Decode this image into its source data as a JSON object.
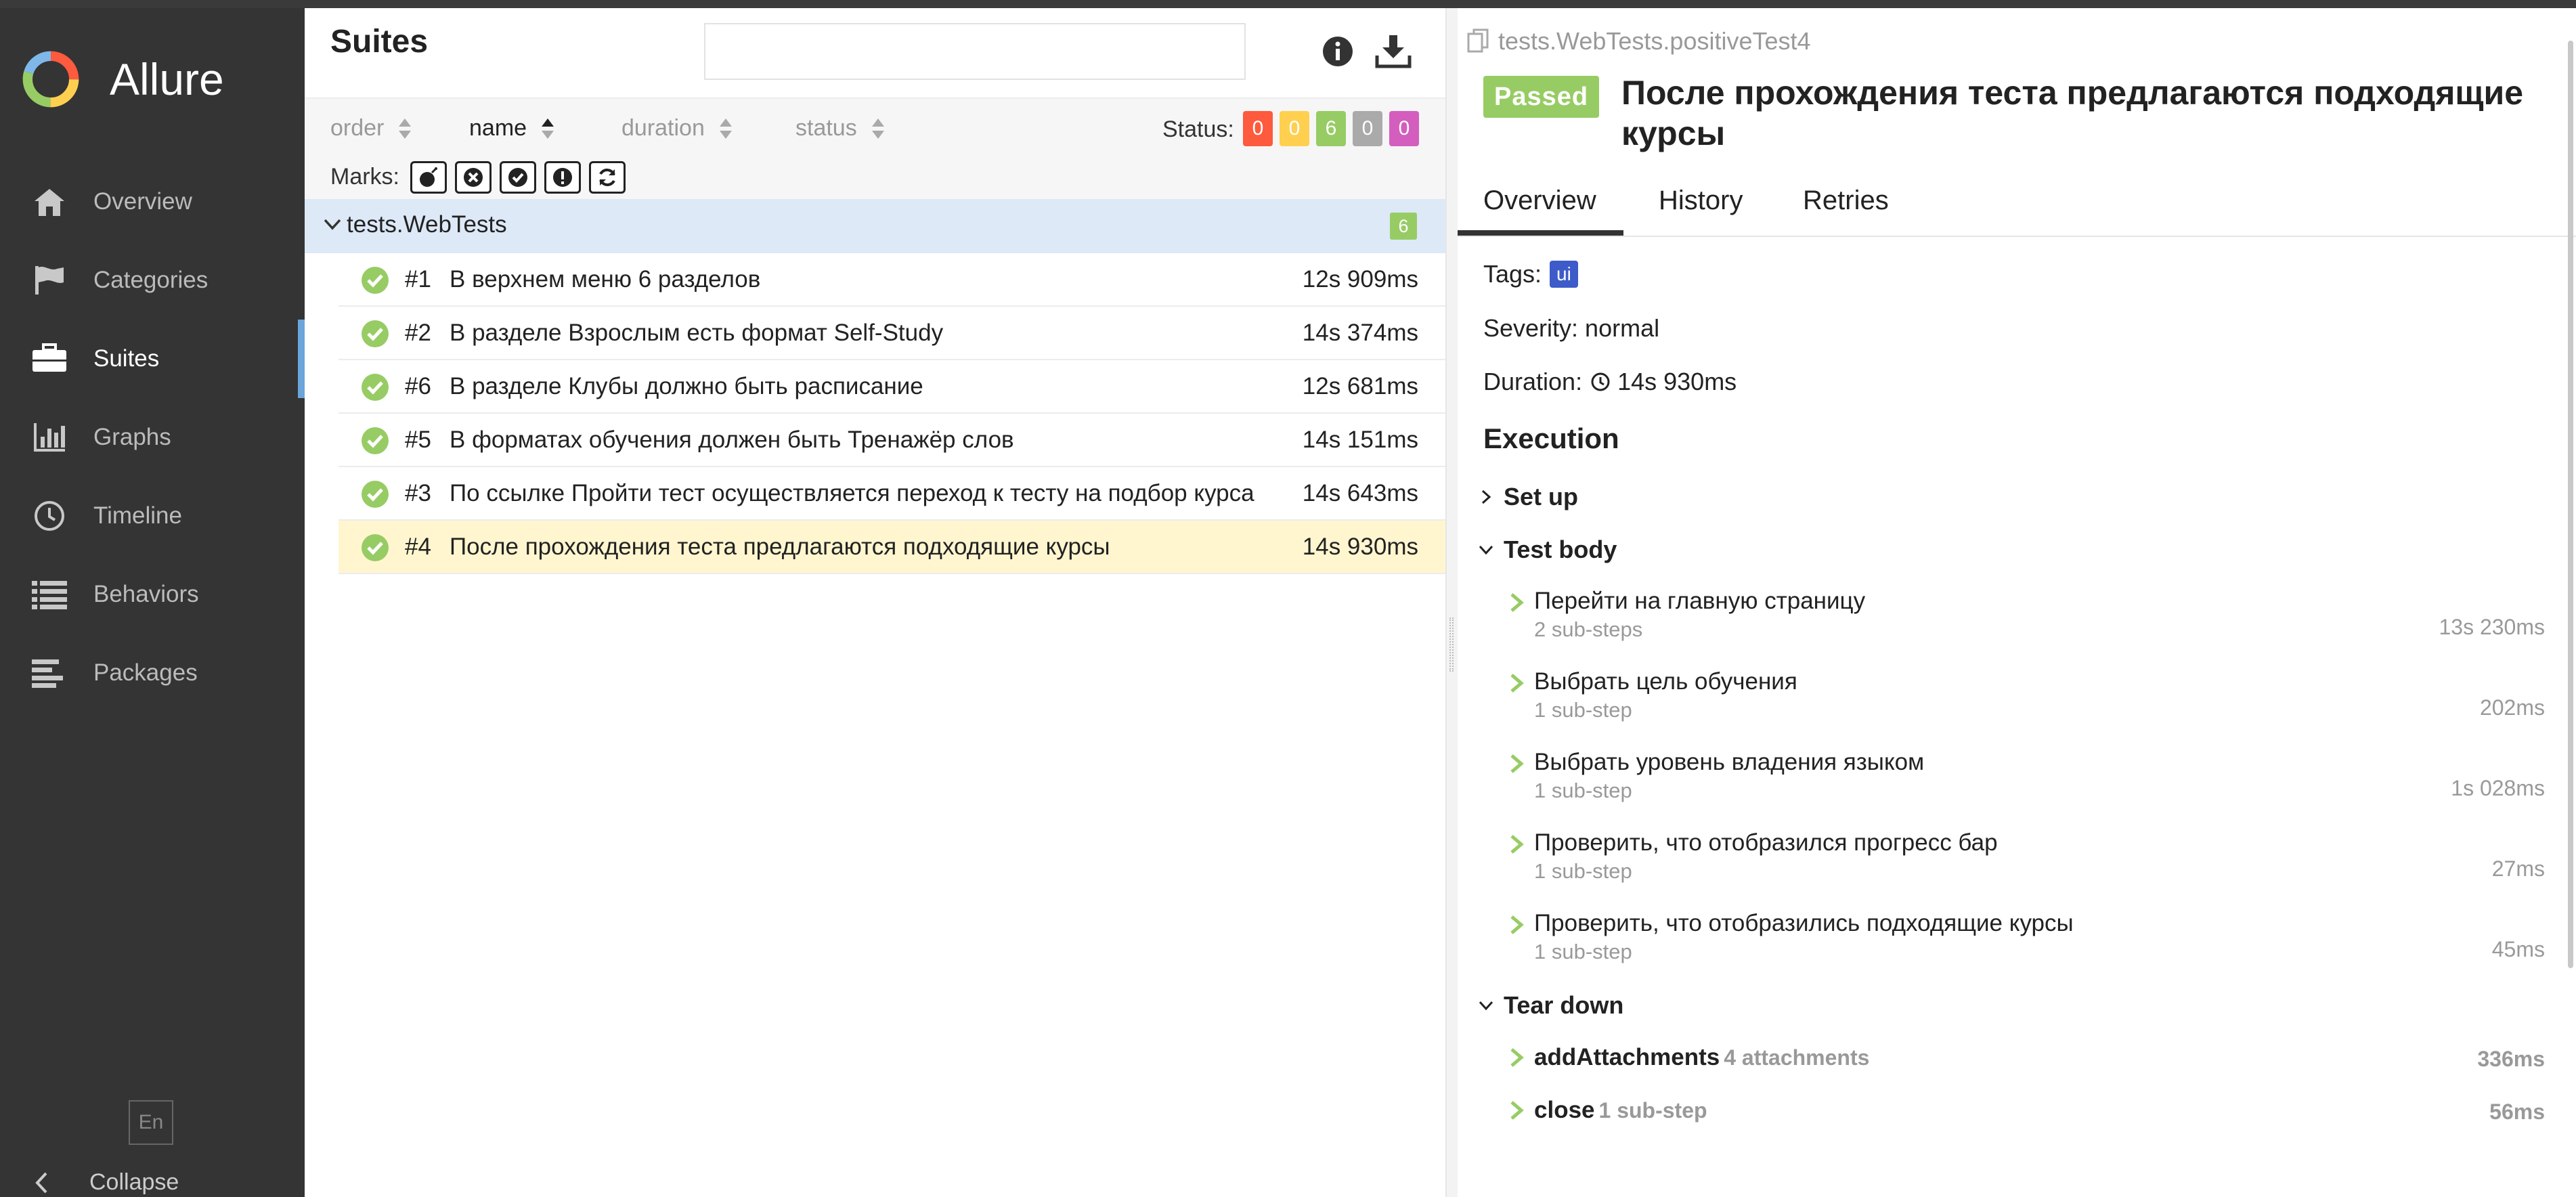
{
  "app": {
    "name": "Allure",
    "accent": "#6aa5dc"
  },
  "sidebar": {
    "items": [
      {
        "label": "Overview",
        "icon": "home-icon"
      },
      {
        "label": "Categories",
        "icon": "flag-icon"
      },
      {
        "label": "Suites",
        "icon": "briefcase-icon",
        "active": true
      },
      {
        "label": "Graphs",
        "icon": "bar-chart-icon"
      },
      {
        "label": "Timeline",
        "icon": "clock-icon"
      },
      {
        "label": "Behaviors",
        "icon": "list-icon"
      },
      {
        "label": "Packages",
        "icon": "align-left-icon"
      }
    ],
    "lang": "En",
    "collapse_label": "Collapse"
  },
  "suites": {
    "title": "Suites",
    "search": {
      "value": "",
      "placeholder": ""
    },
    "sort": {
      "order": "order",
      "name": "name",
      "duration": "duration",
      "status": "status"
    },
    "status_label": "Status:",
    "status_counts": [
      {
        "value": "0",
        "color": "#fd5a3e"
      },
      {
        "value": "0",
        "color": "#ffd050"
      },
      {
        "value": "6",
        "color": "#97cc64"
      },
      {
        "value": "0",
        "color": "#aaaaaa"
      },
      {
        "value": "0",
        "color": "#d35ebe"
      }
    ],
    "marks_label": "Marks:",
    "group": {
      "name": "tests.WebTests",
      "count": "6"
    },
    "rows": [
      {
        "num": "#1",
        "name": "В верхнем меню 6 разделов",
        "duration": "12s 909ms"
      },
      {
        "num": "#2",
        "name": "В разделе Взрослым есть формат Self-Study",
        "duration": "14s 374ms"
      },
      {
        "num": "#6",
        "name": "В разделе Клубы должно быть расписание",
        "duration": "12s 681ms"
      },
      {
        "num": "#5",
        "name": "В форматах обучения должен быть Тренажёр слов",
        "duration": "14s 151ms"
      },
      {
        "num": "#3",
        "name": "По ссылке Пройти тест осуществляется переход к тесту на подбор курса",
        "duration": "14s 643ms"
      },
      {
        "num": "#4",
        "name": "После прохождения теста предлагаются подходящие курсы",
        "duration": "14s 930ms",
        "selected": true
      }
    ]
  },
  "test": {
    "path": "tests.WebTests.positiveTest4",
    "status": "Passed",
    "title": "После прохождения теста предлагаются подходящие курсы",
    "tabs": [
      "Overview",
      "History",
      "Retries"
    ],
    "tags_label": "Tags:",
    "tag": "ui",
    "severity": "Severity: normal",
    "duration_label": "Duration:",
    "duration": "14s 930ms",
    "execution_title": "Execution",
    "setup_label": "Set up",
    "body_label": "Test body",
    "steps": [
      {
        "name": "Перейти на главную страницу",
        "sub": "2 sub-steps",
        "duration": "13s 230ms"
      },
      {
        "name": "Выбрать цель обучения",
        "sub": "1 sub-step",
        "duration": "202ms"
      },
      {
        "name": "Выбрать уровень владения языком",
        "sub": "1 sub-step",
        "duration": "1s 028ms"
      },
      {
        "name": "Проверить, что отобразился прогресс бар",
        "sub": "1 sub-step",
        "duration": "27ms"
      },
      {
        "name": "Проверить, что отобразились подходящие курсы",
        "sub": "1 sub-step",
        "duration": "45ms"
      }
    ],
    "teardown_label": "Tear down",
    "teardown": [
      {
        "name": "addAttachments",
        "sub": "4 attachments",
        "duration": "336ms"
      },
      {
        "name": "close",
        "sub": "1 sub-step",
        "duration": "56ms"
      }
    ]
  }
}
